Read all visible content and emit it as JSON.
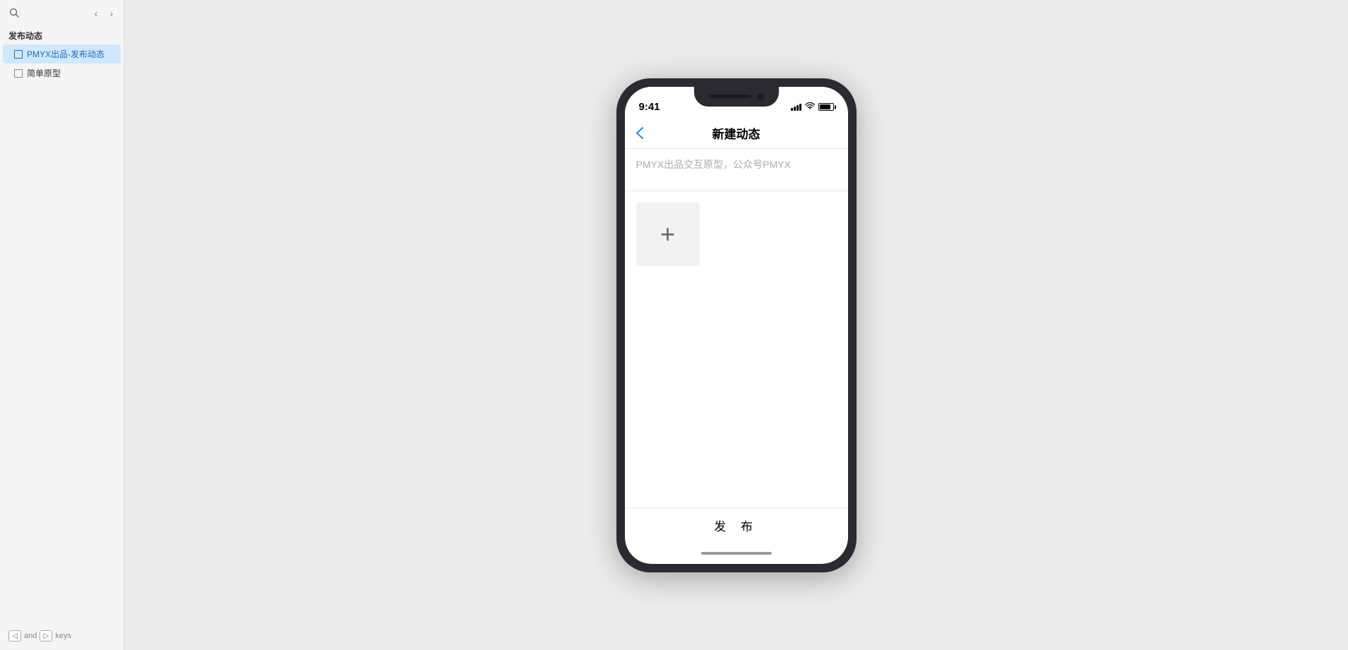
{
  "sidebar": {
    "search_icon": "🔍",
    "nav_back": "‹",
    "nav_forward": "›",
    "section_title": "发布动态",
    "items": [
      {
        "id": "pmyx-post",
        "label": "PMYX出品-发布动态",
        "active": true
      },
      {
        "id": "simple-prototype",
        "label": "简单原型",
        "active": false
      }
    ]
  },
  "bottom_hint": {
    "key1_symbol": "◁",
    "text": "and",
    "key2_symbol": "▷",
    "suffix": "keys"
  },
  "phone": {
    "status_bar": {
      "time": "9:41"
    },
    "nav": {
      "back_icon": "‹",
      "title": "新建动态"
    },
    "content": {
      "text_placeholder": "PMYX出品交互原型，公众号PMYX",
      "add_button_label": "+"
    },
    "publish_button": "发  布"
  }
}
